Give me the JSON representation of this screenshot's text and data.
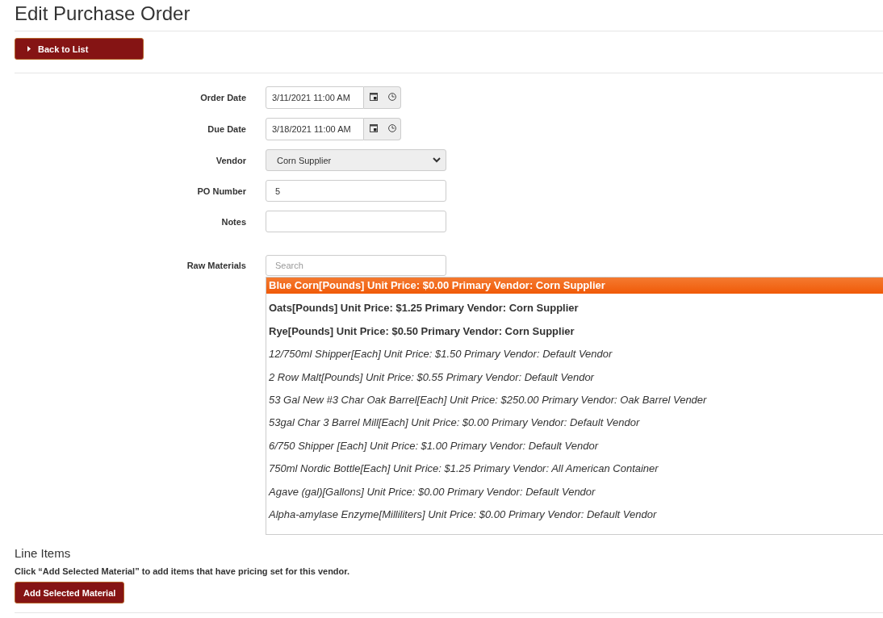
{
  "page": {
    "title": "Edit Purchase Order"
  },
  "back_button": {
    "label": "Back to List"
  },
  "form": {
    "fields": [
      {
        "label": "Order Date",
        "kind": "datetime",
        "value": "3/11/2021 11:00 AM"
      },
      {
        "label": "Due Date",
        "kind": "datetime",
        "value": "3/18/2021 11:00 AM"
      },
      {
        "label": "Vendor",
        "kind": "select",
        "value": "Corn Supplier"
      },
      {
        "label": "PO Number",
        "kind": "text",
        "value": "5"
      },
      {
        "label": "Notes",
        "kind": "text"
      }
    ]
  },
  "raw_materials": {
    "label": "Raw Materials",
    "search": {
      "placeholder": "Search"
    },
    "options": [
      {
        "text": "Blue Corn[Pounds] Unit Price: $0.00 Primary Vendor: Corn Supplier",
        "kind": "vendor",
        "selected": true
      },
      {
        "text": "Oats[Pounds] Unit Price: $1.25 Primary Vendor: Corn Supplier",
        "kind": "vendor",
        "selected": false
      },
      {
        "text": "Rye[Pounds] Unit Price: $0.50 Primary Vendor: Corn Supplier",
        "kind": "vendor",
        "selected": false
      },
      {
        "text": "12/750ml Shipper[Each] Unit Price: $1.50 Primary Vendor: Default Vendor",
        "kind": "other",
        "selected": false
      },
      {
        "text": "2 Row Malt[Pounds] Unit Price: $0.55 Primary Vendor: Default Vendor",
        "kind": "other",
        "selected": false
      },
      {
        "text": "53 Gal New #3 Char Oak Barrel[Each] Unit Price: $250.00 Primary Vendor: Oak Barrel Vender",
        "kind": "other",
        "selected": false
      },
      {
        "text": "53gal Char 3 Barrel Mill[Each] Unit Price: $0.00 Primary Vendor: Default Vendor",
        "kind": "other",
        "selected": false
      },
      {
        "text": "6/750 Shipper [Each] Unit Price: $1.00 Primary Vendor: Default Vendor",
        "kind": "other",
        "selected": false
      },
      {
        "text": "750ml Nordic Bottle[Each] Unit Price: $1.25 Primary Vendor: All American Container",
        "kind": "other",
        "selected": false
      },
      {
        "text": "Agave (gal)[Gallons] Unit Price: $0.00 Primary Vendor: Default Vendor",
        "kind": "other",
        "selected": false
      },
      {
        "text": "Alpha-amylase Enzyme[Milliliters] Unit Price: $0.00 Primary Vendor: Default Vendor",
        "kind": "other",
        "selected": false
      }
    ]
  },
  "line_items": {
    "heading": "Line Items",
    "hint": "Click “Add Selected Material” to add items that have pricing set for this vendor.",
    "button": "Add Selected Material"
  }
}
